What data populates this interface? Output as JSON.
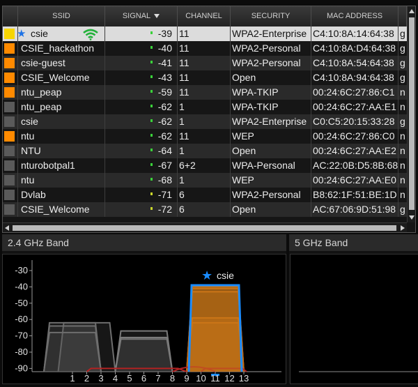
{
  "table": {
    "columns": [
      "SSID",
      "SIGNAL",
      "CHANNEL",
      "SECURITY",
      "MAC ADDRESS"
    ],
    "rows": [
      {
        "color": "#f7d500",
        "ssid": "csie",
        "signal": "-39",
        "channel": "11",
        "security": "WPA2-Enterprise",
        "mac": "C4:10:8A:14:64:38",
        "extra": "g",
        "selected": true,
        "favorite": true,
        "connected": true
      },
      {
        "color": "#ff8a00",
        "ssid": "CSIE_hackathon",
        "signal": "-40",
        "channel": "11",
        "security": "WPA2-Personal",
        "mac": "C4:10:8A:D4:64:38",
        "extra": "g"
      },
      {
        "color": "#ff8a00",
        "ssid": "csie-guest",
        "signal": "-41",
        "channel": "11",
        "security": "WPA2-Personal",
        "mac": "C4:10:8A:54:64:38",
        "extra": "g"
      },
      {
        "color": "#ff8a00",
        "ssid": "CSIE_Welcome",
        "signal": "-43",
        "channel": "11",
        "security": "Open",
        "mac": "C4:10:8A:94:64:38",
        "extra": "g"
      },
      {
        "color": "#ff8a00",
        "ssid": "ntu_peap",
        "signal": "-59",
        "channel": "11",
        "security": "WPA-TKIP",
        "mac": "00:24:6C:27:86:C1",
        "extra": "n"
      },
      {
        "color": "#5a5a5a",
        "ssid": "ntu_peap",
        "signal": "-62",
        "channel": "1",
        "security": "WPA-TKIP",
        "mac": "00:24:6C:27:AA:E1",
        "extra": "n"
      },
      {
        "color": "#5a5a5a",
        "ssid": "csie",
        "signal": "-62",
        "channel": "1",
        "security": "WPA2-Enterprise",
        "mac": "C0:C5:20:15:33:28",
        "extra": "g"
      },
      {
        "color": "#ff8a00",
        "ssid": "ntu",
        "signal": "-62",
        "channel": "11",
        "security": "WEP",
        "mac": "00:24:6C:27:86:C0",
        "extra": "n"
      },
      {
        "color": "#5a5a5a",
        "ssid": "NTU",
        "signal": "-64",
        "channel": "1",
        "security": "Open",
        "mac": "00:24:6C:27:AA:E2",
        "extra": "n"
      },
      {
        "color": "#5a5a5a",
        "ssid": "nturobotpal1",
        "signal": "-67",
        "channel": "6+2",
        "security": "WPA-Personal",
        "mac": "AC:22:0B:D5:8B:68",
        "extra": "n"
      },
      {
        "color": "#5a5a5a",
        "ssid": "ntu",
        "signal": "-68",
        "channel": "1",
        "security": "WEP",
        "mac": "00:24:6C:27:AA:E0",
        "extra": "n"
      },
      {
        "color": "#5a5a5a",
        "ssid": "Dvlab",
        "signal": "-71",
        "channel": "6",
        "security": "WPA2-Personal",
        "mac": "B8:62:1F:51:BE:1D",
        "extra": "n"
      },
      {
        "color": "#5a5a5a",
        "ssid": "CSIE_Welcome",
        "signal": "-72",
        "channel": "6",
        "security": "Open",
        "mac": "AC:67:06:9D:51:98",
        "extra": "g"
      }
    ]
  },
  "band24": {
    "title": "2.4 GHz Band",
    "y_ticks": [
      "-30",
      "-40",
      "-50",
      "-60",
      "-70",
      "-80",
      "-90"
    ],
    "x_ticks": [
      "1",
      "2",
      "3",
      "4",
      "5",
      "6",
      "7",
      "8",
      "9",
      "10",
      "11",
      "12",
      "13"
    ],
    "highlight_label": "csie",
    "highlight_channel": 11,
    "highlight_signal": -39
  },
  "band5": {
    "title": "5 GHz Band"
  },
  "colors": {
    "selected": "#1a8cff",
    "orange": "#ff8a00",
    "yellow": "#f7d500",
    "grey": "#5a5a5a"
  }
}
